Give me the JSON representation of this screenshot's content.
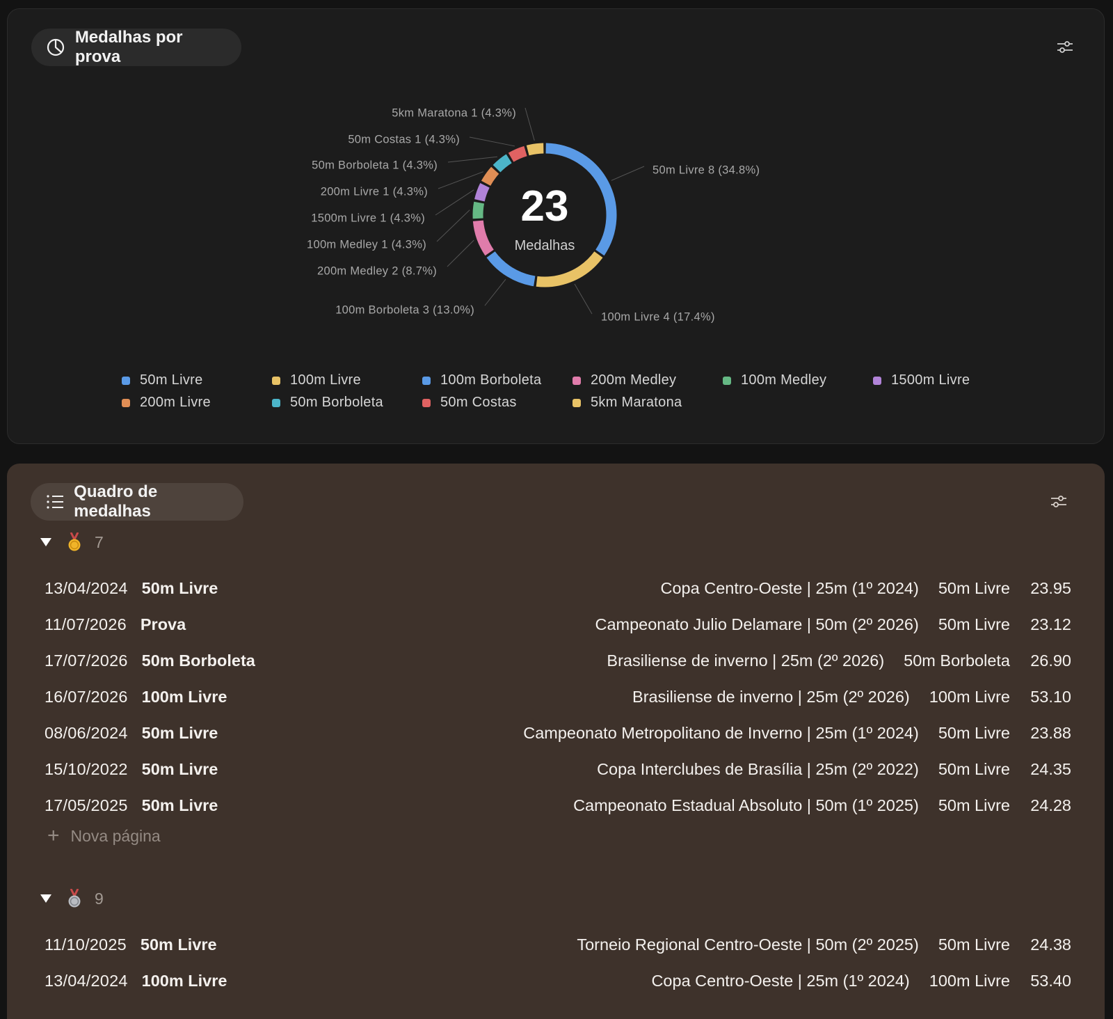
{
  "chart_card": {
    "title": "Medalhas por prova",
    "title_icon": "pie-chart-icon",
    "settings_icon": "sliders-icon"
  },
  "chart_data": {
    "type": "pie",
    "donut": true,
    "center_value": "23",
    "center_label": "Medalhas",
    "slices": [
      {
        "name": "50m Livre",
        "value": 8,
        "pct": "34.8%",
        "label": "50m Livre  8 (34.8%)",
        "color": "#5a9ae6"
      },
      {
        "name": "100m Livre",
        "value": 4,
        "pct": "17.4%",
        "label": "100m Livre  4 (17.4%)",
        "color": "#e8c266"
      },
      {
        "name": "100m Borboleta",
        "value": 3,
        "pct": "13.0%",
        "label": "100m Borboleta  3 (13.0%)",
        "color": "#5a9ae6"
      },
      {
        "name": "200m Medley",
        "value": 2,
        "pct": "8.7%",
        "label": "200m Medley  2 (8.7%)",
        "color": "#e07cab"
      },
      {
        "name": "100m Medley",
        "value": 1,
        "pct": "4.3%",
        "label": "100m Medley  1 (4.3%)",
        "color": "#65b884"
      },
      {
        "name": "1500m Livre",
        "value": 1,
        "pct": "4.3%",
        "label": "1500m Livre  1 (4.3%)",
        "color": "#b183d8"
      },
      {
        "name": "200m Livre",
        "value": 1,
        "pct": "4.3%",
        "label": "200m Livre  1 (4.3%)",
        "color": "#e08e55"
      },
      {
        "name": "50m Borboleta",
        "value": 1,
        "pct": "4.3%",
        "label": "50m Borboleta  1 (4.3%)",
        "color": "#4cb5c9"
      },
      {
        "name": "50m Costas",
        "value": 1,
        "pct": "4.3%",
        "label": "50m Costas  1 (4.3%)",
        "color": "#e06262"
      },
      {
        "name": "5km Maratona",
        "value": 1,
        "pct": "4.3%",
        "label": "5km Maratona  1 (4.3%)",
        "color": "#e8c266"
      }
    ],
    "legend": [
      {
        "name": "50m Livre",
        "color": "#5a9ae6"
      },
      {
        "name": "100m Livre",
        "color": "#e8c266"
      },
      {
        "name": "100m Borboleta",
        "color": "#5a9ae6"
      },
      {
        "name": "200m Medley",
        "color": "#e07cab"
      },
      {
        "name": "100m Medley",
        "color": "#65b884"
      },
      {
        "name": "1500m Livre",
        "color": "#b183d8"
      },
      {
        "name": "200m Livre",
        "color": "#e08e55"
      },
      {
        "name": "50m Borboleta",
        "color": "#4cb5c9"
      },
      {
        "name": "50m Costas",
        "color": "#e06262"
      },
      {
        "name": "5km Maratona",
        "color": "#e8c266"
      }
    ],
    "legend_position": "bottom"
  },
  "table_card": {
    "title": "Quadro de medalhas",
    "title_icon": "list-icon",
    "settings_icon": "sliders-icon",
    "new_page_label": "Nova página",
    "groups": [
      {
        "medal": "gold-medal-icon",
        "count": "7",
        "rows": [
          {
            "date": "13/04/2024",
            "name": "50m Livre",
            "competition": "Copa Centro-Oeste | 25m (1º 2024)",
            "prova": "50m Livre",
            "time": "23.95"
          },
          {
            "date": "11/07/2026",
            "name": "Prova",
            "competition": "Campeonato Julio Delamare | 50m (2º 2026)",
            "prova": "50m Livre",
            "time": "23.12"
          },
          {
            "date": "17/07/2026",
            "name": "50m Borboleta",
            "competition": "Brasiliense de inverno | 25m (2º 2026)",
            "prova": "50m Borboleta",
            "time": "26.90"
          },
          {
            "date": "16/07/2026",
            "name": "100m Livre",
            "competition": "Brasiliense de inverno | 25m (2º 2026)",
            "prova": "100m Livre",
            "time": "53.10"
          },
          {
            "date": "08/06/2024",
            "name": "50m Livre",
            "competition": "Campeonato Metropolitano de Inverno | 25m (1º 2024)",
            "prova": "50m Livre",
            "time": "23.88"
          },
          {
            "date": "15/10/2022",
            "name": "50m Livre",
            "competition": "Copa Interclubes de Brasília | 25m (2º 2022)",
            "prova": "50m Livre",
            "time": "24.35"
          },
          {
            "date": "17/05/2025",
            "name": "50m Livre",
            "competition": "Campeonato Estadual Absoluto | 50m (1º 2025)",
            "prova": "50m Livre",
            "time": "24.28"
          }
        ]
      },
      {
        "medal": "silver-medal-icon",
        "count": "9",
        "rows": [
          {
            "date": "11/10/2025",
            "name": "50m Livre",
            "competition": "Torneio Regional Centro-Oeste | 50m (2º 2025)",
            "prova": "50m Livre",
            "time": "24.38"
          },
          {
            "date": "13/04/2024",
            "name": "100m Livre",
            "competition": "Copa Centro-Oeste | 25m (1º 2024)",
            "prova": "100m Livre",
            "time": "53.40"
          }
        ]
      }
    ]
  }
}
